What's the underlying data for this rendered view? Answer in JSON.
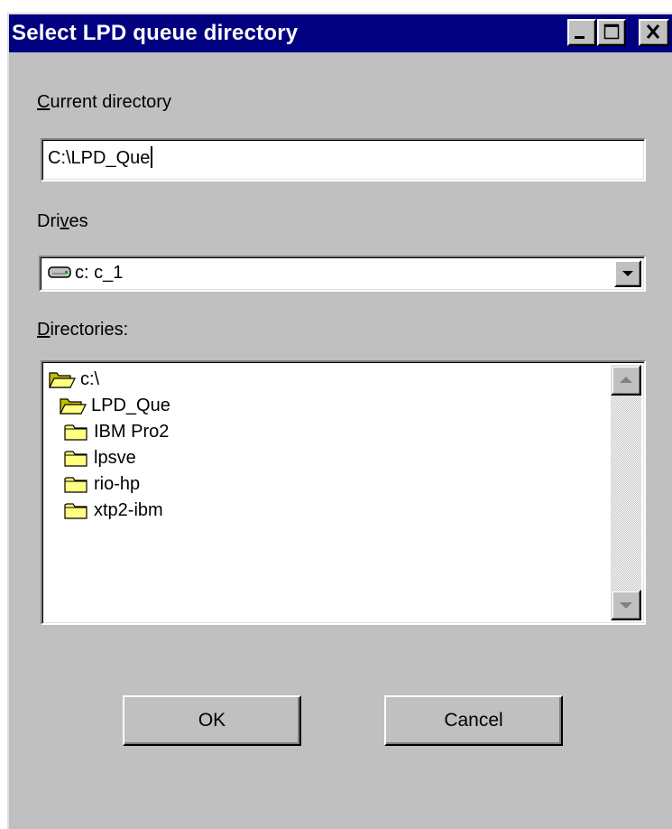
{
  "window": {
    "title": "Select LPD queue directory",
    "controls": {
      "minimize": "minimize",
      "maximize": "maximize",
      "close": "close"
    }
  },
  "current_directory": {
    "label_prefix": "",
    "label_access_key": "C",
    "label_rest": "urrent directory",
    "value": "C:\\LPD_Que"
  },
  "drives": {
    "label_prefix": "Dri",
    "label_access_key": "v",
    "label_rest": "es",
    "selected": "c: c_1",
    "icon": "drive-icon"
  },
  "directories": {
    "label_prefix": "",
    "label_access_key": "D",
    "label_rest": "irectories:",
    "items": [
      {
        "label": "c:\\",
        "icon": "open-folder-icon",
        "level": 0
      },
      {
        "label": "LPD_Que",
        "icon": "open-folder-icon",
        "level": 1
      },
      {
        "label": "IBM Pro2",
        "icon": "folder-icon",
        "level": 2
      },
      {
        "label": "lpsve",
        "icon": "folder-icon",
        "level": 2
      },
      {
        "label": "rio-hp",
        "icon": "folder-icon",
        "level": 2
      },
      {
        "label": "xtp2-ibm",
        "icon": "folder-icon",
        "level": 2
      }
    ]
  },
  "buttons": {
    "ok": "OK",
    "cancel": "Cancel"
  },
  "colors": {
    "titlebar": "#000080",
    "face": "#c0c0c0",
    "folder": "#ffff80"
  }
}
